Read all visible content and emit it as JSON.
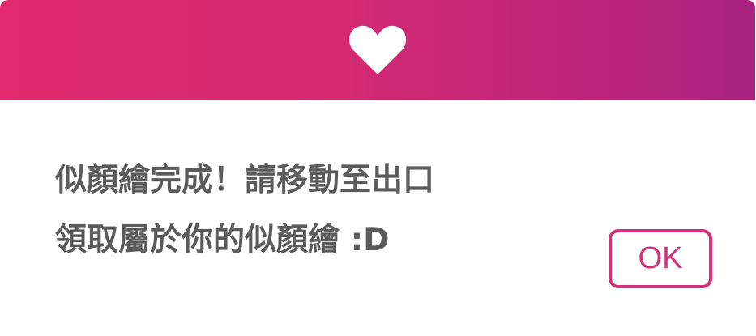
{
  "dialog": {
    "header": {
      "icon": "heart-icon",
      "gradient_start": "#e0296e",
      "gradient_end": "#a92380"
    },
    "message": {
      "line1": "似顏繪完成！請移動至出口",
      "line2": "領取屬於你的似顏繪 :D"
    },
    "ok_button": {
      "label": "OK",
      "color": "#d6307a"
    }
  }
}
